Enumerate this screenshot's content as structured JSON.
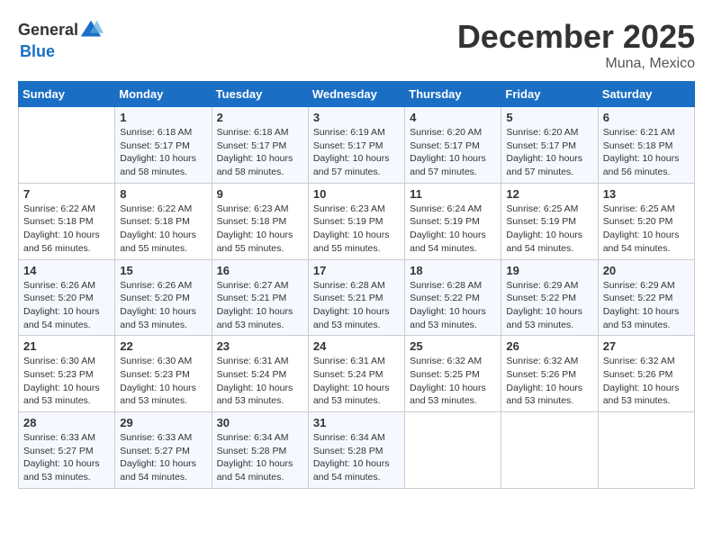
{
  "logo": {
    "general": "General",
    "blue": "Blue"
  },
  "title": "December 2025",
  "location": "Muna, Mexico",
  "days_header": [
    "Sunday",
    "Monday",
    "Tuesday",
    "Wednesday",
    "Thursday",
    "Friday",
    "Saturday"
  ],
  "weeks": [
    [
      {
        "day": "",
        "info": ""
      },
      {
        "day": "1",
        "info": "Sunrise: 6:18 AM\nSunset: 5:17 PM\nDaylight: 10 hours\nand 58 minutes."
      },
      {
        "day": "2",
        "info": "Sunrise: 6:18 AM\nSunset: 5:17 PM\nDaylight: 10 hours\nand 58 minutes."
      },
      {
        "day": "3",
        "info": "Sunrise: 6:19 AM\nSunset: 5:17 PM\nDaylight: 10 hours\nand 57 minutes."
      },
      {
        "day": "4",
        "info": "Sunrise: 6:20 AM\nSunset: 5:17 PM\nDaylight: 10 hours\nand 57 minutes."
      },
      {
        "day": "5",
        "info": "Sunrise: 6:20 AM\nSunset: 5:17 PM\nDaylight: 10 hours\nand 57 minutes."
      },
      {
        "day": "6",
        "info": "Sunrise: 6:21 AM\nSunset: 5:18 PM\nDaylight: 10 hours\nand 56 minutes."
      }
    ],
    [
      {
        "day": "7",
        "info": "Sunrise: 6:22 AM\nSunset: 5:18 PM\nDaylight: 10 hours\nand 56 minutes."
      },
      {
        "day": "8",
        "info": "Sunrise: 6:22 AM\nSunset: 5:18 PM\nDaylight: 10 hours\nand 55 minutes."
      },
      {
        "day": "9",
        "info": "Sunrise: 6:23 AM\nSunset: 5:18 PM\nDaylight: 10 hours\nand 55 minutes."
      },
      {
        "day": "10",
        "info": "Sunrise: 6:23 AM\nSunset: 5:19 PM\nDaylight: 10 hours\nand 55 minutes."
      },
      {
        "day": "11",
        "info": "Sunrise: 6:24 AM\nSunset: 5:19 PM\nDaylight: 10 hours\nand 54 minutes."
      },
      {
        "day": "12",
        "info": "Sunrise: 6:25 AM\nSunset: 5:19 PM\nDaylight: 10 hours\nand 54 minutes."
      },
      {
        "day": "13",
        "info": "Sunrise: 6:25 AM\nSunset: 5:20 PM\nDaylight: 10 hours\nand 54 minutes."
      }
    ],
    [
      {
        "day": "14",
        "info": "Sunrise: 6:26 AM\nSunset: 5:20 PM\nDaylight: 10 hours\nand 54 minutes."
      },
      {
        "day": "15",
        "info": "Sunrise: 6:26 AM\nSunset: 5:20 PM\nDaylight: 10 hours\nand 53 minutes."
      },
      {
        "day": "16",
        "info": "Sunrise: 6:27 AM\nSunset: 5:21 PM\nDaylight: 10 hours\nand 53 minutes."
      },
      {
        "day": "17",
        "info": "Sunrise: 6:28 AM\nSunset: 5:21 PM\nDaylight: 10 hours\nand 53 minutes."
      },
      {
        "day": "18",
        "info": "Sunrise: 6:28 AM\nSunset: 5:22 PM\nDaylight: 10 hours\nand 53 minutes."
      },
      {
        "day": "19",
        "info": "Sunrise: 6:29 AM\nSunset: 5:22 PM\nDaylight: 10 hours\nand 53 minutes."
      },
      {
        "day": "20",
        "info": "Sunrise: 6:29 AM\nSunset: 5:22 PM\nDaylight: 10 hours\nand 53 minutes."
      }
    ],
    [
      {
        "day": "21",
        "info": "Sunrise: 6:30 AM\nSunset: 5:23 PM\nDaylight: 10 hours\nand 53 minutes."
      },
      {
        "day": "22",
        "info": "Sunrise: 6:30 AM\nSunset: 5:23 PM\nDaylight: 10 hours\nand 53 minutes."
      },
      {
        "day": "23",
        "info": "Sunrise: 6:31 AM\nSunset: 5:24 PM\nDaylight: 10 hours\nand 53 minutes."
      },
      {
        "day": "24",
        "info": "Sunrise: 6:31 AM\nSunset: 5:24 PM\nDaylight: 10 hours\nand 53 minutes."
      },
      {
        "day": "25",
        "info": "Sunrise: 6:32 AM\nSunset: 5:25 PM\nDaylight: 10 hours\nand 53 minutes."
      },
      {
        "day": "26",
        "info": "Sunrise: 6:32 AM\nSunset: 5:26 PM\nDaylight: 10 hours\nand 53 minutes."
      },
      {
        "day": "27",
        "info": "Sunrise: 6:32 AM\nSunset: 5:26 PM\nDaylight: 10 hours\nand 53 minutes."
      }
    ],
    [
      {
        "day": "28",
        "info": "Sunrise: 6:33 AM\nSunset: 5:27 PM\nDaylight: 10 hours\nand 53 minutes."
      },
      {
        "day": "29",
        "info": "Sunrise: 6:33 AM\nSunset: 5:27 PM\nDaylight: 10 hours\nand 54 minutes."
      },
      {
        "day": "30",
        "info": "Sunrise: 6:34 AM\nSunset: 5:28 PM\nDaylight: 10 hours\nand 54 minutes."
      },
      {
        "day": "31",
        "info": "Sunrise: 6:34 AM\nSunset: 5:28 PM\nDaylight: 10 hours\nand 54 minutes."
      },
      {
        "day": "",
        "info": ""
      },
      {
        "day": "",
        "info": ""
      },
      {
        "day": "",
        "info": ""
      }
    ]
  ]
}
